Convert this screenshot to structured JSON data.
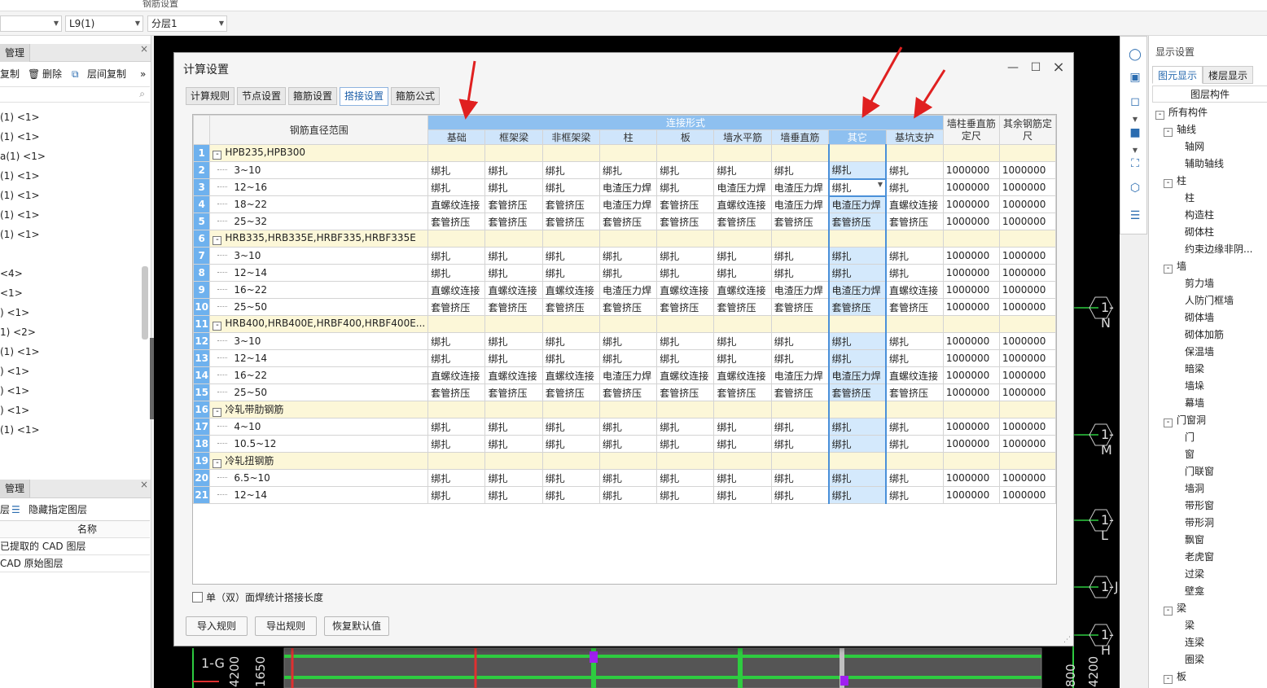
{
  "top_strip": {
    "title": "钢筋设置"
  },
  "toolbar": {
    "combo1": "",
    "combo2": "L9(1)",
    "combo3": "分层1"
  },
  "left_panel": {
    "tab1": "管理",
    "toolbar": {
      "copy": "复制",
      "delete": "删除",
      "floor_copy": "层间复制"
    },
    "tree": [
      "(1) <1>",
      "(1) <1>",
      "a(1) <1>",
      "(1) <1>",
      "(1) <1>",
      "(1) <1>",
      "(1) <1>",
      "",
      " <4>",
      " <1>",
      ") <1>",
      "1) <2>",
      "(1) <1>",
      ") <1>",
      ") <1>",
      ") <1>",
      "(1) <1>"
    ],
    "tab2": "管理",
    "layer_toolbar": {
      "a": "层",
      "hide": "隐藏指定图层"
    },
    "layer_header": "名称",
    "layers": [
      "已提取的 CAD 图层",
      "CAD 原始图层"
    ]
  },
  "cad": {
    "axes": [
      "1-N",
      "1-M",
      "1-L",
      "1-J",
      "1-H",
      "1-G"
    ],
    "dims": [
      "4200",
      "1650",
      "800",
      "4200"
    ]
  },
  "right_panel": {
    "title": "显示设置",
    "tabs": [
      "图元显示",
      "楼层显示"
    ],
    "header": "图层构件",
    "items": [
      {
        "t": "所有构件",
        "lvl": 0,
        "box": "-"
      },
      {
        "t": "轴线",
        "lvl": 1,
        "box": "-"
      },
      {
        "t": "轴网",
        "lvl": 2
      },
      {
        "t": "辅助轴线",
        "lvl": 2
      },
      {
        "t": "柱",
        "lvl": 1,
        "box": "-"
      },
      {
        "t": "柱",
        "lvl": 2
      },
      {
        "t": "构造柱",
        "lvl": 2
      },
      {
        "t": "砌体柱",
        "lvl": 2
      },
      {
        "t": "约束边缘非阴...",
        "lvl": 2
      },
      {
        "t": "墙",
        "lvl": 1,
        "box": "-"
      },
      {
        "t": "剪力墙",
        "lvl": 2
      },
      {
        "t": "人防门框墙",
        "lvl": 2
      },
      {
        "t": "砌体墙",
        "lvl": 2
      },
      {
        "t": "砌体加筋",
        "lvl": 2
      },
      {
        "t": "保温墙",
        "lvl": 2
      },
      {
        "t": "暗梁",
        "lvl": 2
      },
      {
        "t": "墙垛",
        "lvl": 2
      },
      {
        "t": "幕墙",
        "lvl": 2
      },
      {
        "t": "门窗洞",
        "lvl": 1,
        "box": "-"
      },
      {
        "t": "门",
        "lvl": 2
      },
      {
        "t": "窗",
        "lvl": 2
      },
      {
        "t": "门联窗",
        "lvl": 2
      },
      {
        "t": "墙洞",
        "lvl": 2
      },
      {
        "t": "带形窗",
        "lvl": 2
      },
      {
        "t": "带形洞",
        "lvl": 2
      },
      {
        "t": "飘窗",
        "lvl": 2
      },
      {
        "t": "老虎窗",
        "lvl": 2
      },
      {
        "t": "过梁",
        "lvl": 2
      },
      {
        "t": "壁龛",
        "lvl": 2
      },
      {
        "t": "梁",
        "lvl": 1,
        "box": "-"
      },
      {
        "t": "梁",
        "lvl": 2
      },
      {
        "t": "连梁",
        "lvl": 2
      },
      {
        "t": "圈梁",
        "lvl": 2
      },
      {
        "t": "板",
        "lvl": 1,
        "box": "-"
      }
    ]
  },
  "dialog": {
    "title": "计算设置",
    "tabs": [
      "计算规则",
      "节点设置",
      "箍筋设置",
      "搭接设置",
      "箍筋公式"
    ],
    "active_tab": 3,
    "table": {
      "col0_header": "钢筋直径范围",
      "group_header": "连接形式",
      "sub_headers": [
        "基础",
        "框架梁",
        "非框架梁",
        "柱",
        "板",
        "墙水平筋",
        "墙垂直筋",
        "其它",
        "基坑支护"
      ],
      "extra_headers": [
        "墙柱垂直筋定尺",
        "其余钢筋定尺"
      ],
      "rows": [
        {
          "n": "1",
          "group": true,
          "label": "HPB235,HPB300"
        },
        {
          "n": "2",
          "label": "3~10",
          "cells": [
            "绑扎",
            "绑扎",
            "绑扎",
            "绑扎",
            "绑扎",
            "绑扎",
            "绑扎",
            "绑扎",
            "绑扎",
            "1000000",
            "1000000"
          ]
        },
        {
          "n": "3",
          "label": "12~16",
          "cells": [
            "绑扎",
            "绑扎",
            "绑扎",
            "电渣压力焊",
            "绑扎",
            "电渣压力焊",
            "电渣压力焊",
            "绑扎",
            "绑扎",
            "1000000",
            "1000000"
          ]
        },
        {
          "n": "4",
          "label": "18~22",
          "cells": [
            "直螺纹连接",
            "套管挤压",
            "套管挤压",
            "电渣压力焊",
            "套管挤压",
            "直螺纹连接",
            "电渣压力焊",
            "电渣压力焊",
            "直螺纹连接",
            "1000000",
            "1000000"
          ]
        },
        {
          "n": "5",
          "label": "25~32",
          "cells": [
            "套管挤压",
            "套管挤压",
            "套管挤压",
            "套管挤压",
            "套管挤压",
            "套管挤压",
            "套管挤压",
            "套管挤压",
            "套管挤压",
            "1000000",
            "1000000"
          ]
        },
        {
          "n": "6",
          "group": true,
          "label": "HRB335,HRB335E,HRBF335,HRBF335E"
        },
        {
          "n": "7",
          "label": "3~10",
          "cells": [
            "绑扎",
            "绑扎",
            "绑扎",
            "绑扎",
            "绑扎",
            "绑扎",
            "绑扎",
            "绑扎",
            "绑扎",
            "1000000",
            "1000000"
          ]
        },
        {
          "n": "8",
          "label": "12~14",
          "cells": [
            "绑扎",
            "绑扎",
            "绑扎",
            "绑扎",
            "绑扎",
            "绑扎",
            "绑扎",
            "绑扎",
            "绑扎",
            "1000000",
            "1000000"
          ]
        },
        {
          "n": "9",
          "label": "16~22",
          "cells": [
            "直螺纹连接",
            "直螺纹连接",
            "直螺纹连接",
            "电渣压力焊",
            "直螺纹连接",
            "直螺纹连接",
            "电渣压力焊",
            "电渣压力焊",
            "直螺纹连接",
            "1000000",
            "1000000"
          ]
        },
        {
          "n": "10",
          "label": "25~50",
          "cells": [
            "套管挤压",
            "套管挤压",
            "套管挤压",
            "套管挤压",
            "套管挤压",
            "套管挤压",
            "套管挤压",
            "套管挤压",
            "套管挤压",
            "1000000",
            "1000000"
          ]
        },
        {
          "n": "11",
          "group": true,
          "label": "HRB400,HRB400E,HRBF400,HRBF400E..."
        },
        {
          "n": "12",
          "label": "3~10",
          "cells": [
            "绑扎",
            "绑扎",
            "绑扎",
            "绑扎",
            "绑扎",
            "绑扎",
            "绑扎",
            "绑扎",
            "绑扎",
            "1000000",
            "1000000"
          ]
        },
        {
          "n": "13",
          "label": "12~14",
          "cells": [
            "绑扎",
            "绑扎",
            "绑扎",
            "绑扎",
            "绑扎",
            "绑扎",
            "绑扎",
            "绑扎",
            "绑扎",
            "1000000",
            "1000000"
          ]
        },
        {
          "n": "14",
          "label": "16~22",
          "cells": [
            "直螺纹连接",
            "直螺纹连接",
            "直螺纹连接",
            "电渣压力焊",
            "直螺纹连接",
            "直螺纹连接",
            "电渣压力焊",
            "电渣压力焊",
            "直螺纹连接",
            "1000000",
            "1000000"
          ]
        },
        {
          "n": "15",
          "label": "25~50",
          "cells": [
            "套管挤压",
            "套管挤压",
            "套管挤压",
            "套管挤压",
            "套管挤压",
            "套管挤压",
            "套管挤压",
            "套管挤压",
            "套管挤压",
            "1000000",
            "1000000"
          ]
        },
        {
          "n": "16",
          "group": true,
          "label": "冷轧带肋钢筋"
        },
        {
          "n": "17",
          "label": "4~10",
          "cells": [
            "绑扎",
            "绑扎",
            "绑扎",
            "绑扎",
            "绑扎",
            "绑扎",
            "绑扎",
            "绑扎",
            "绑扎",
            "1000000",
            "1000000"
          ]
        },
        {
          "n": "18",
          "label": "10.5~12",
          "cells": [
            "绑扎",
            "绑扎",
            "绑扎",
            "绑扎",
            "绑扎",
            "绑扎",
            "绑扎",
            "绑扎",
            "绑扎",
            "1000000",
            "1000000"
          ]
        },
        {
          "n": "19",
          "group": true,
          "label": "冷轧扭钢筋"
        },
        {
          "n": "20",
          "label": "6.5~10",
          "cells": [
            "绑扎",
            "绑扎",
            "绑扎",
            "绑扎",
            "绑扎",
            "绑扎",
            "绑扎",
            "绑扎",
            "绑扎",
            "1000000",
            "1000000"
          ]
        },
        {
          "n": "21",
          "label": "12~14",
          "cells": [
            "绑扎",
            "绑扎",
            "绑扎",
            "绑扎",
            "绑扎",
            "绑扎",
            "绑扎",
            "绑扎",
            "绑扎",
            "1000000",
            "1000000"
          ]
        }
      ]
    },
    "checkbox_label": "单（双）面焊统计搭接长度",
    "buttons": [
      "导入规则",
      "导出规则",
      "恢复默认值"
    ]
  },
  "colors": {
    "accent": "#6eb1ee",
    "selected_col": "#d4e9fc",
    "group_row": "#fcf7d8",
    "annotation_arrow": "#e02020"
  }
}
